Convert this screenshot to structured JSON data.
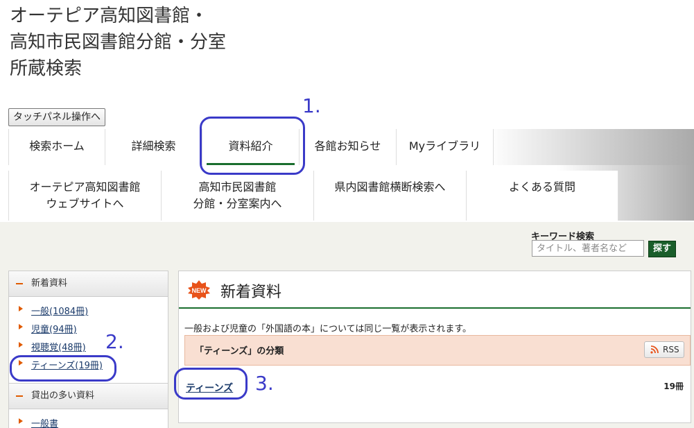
{
  "site_title": {
    "line1": "オーテピア高知図書館・",
    "line2": "高知市民図書館分館・分室",
    "line3": "所蔵検索"
  },
  "touch_panel_label": "タッチパネル操作へ",
  "nav_tabs": [
    {
      "label": "検索ホーム"
    },
    {
      "label": "詳細検索"
    },
    {
      "label": "資料紹介"
    },
    {
      "label": "各館お知らせ"
    },
    {
      "label": "Myライブラリ"
    }
  ],
  "nav_links": [
    {
      "line1": "オーテピア高知図書館",
      "line2": "ウェブサイトへ"
    },
    {
      "line1": "高知市民図書館",
      "line2": "分館・分室案内へ"
    },
    {
      "line1": "県内図書館横断検索へ",
      "line2": ""
    },
    {
      "line1": "よくある質問",
      "line2": ""
    }
  ],
  "keyword_search": {
    "label": "キーワード検索",
    "placeholder": "タイトル、著者名など",
    "button": "探す"
  },
  "sidebar": {
    "new_header": "新着資料",
    "new_items": [
      {
        "label": "一般(1084冊)"
      },
      {
        "label": "児童(94冊)"
      },
      {
        "label": "視聴覚(48冊)"
      },
      {
        "label": "ティーンズ(19冊)"
      }
    ],
    "popular_header": "貸出の多い資料",
    "popular_items": [
      {
        "label": "一般書"
      }
    ]
  },
  "main": {
    "badge": "NEW",
    "title": "新着資料",
    "note": "一般および児童の「外国語の本」については同じ一覧が表示されます。",
    "class_title": "「ティーンズ」の分類",
    "rss_label": "RSS",
    "result_link": "ティーンズ",
    "result_count": "19冊"
  },
  "annotations": [
    "1.",
    "2.",
    "3."
  ],
  "colors": {
    "accent_green": "#1a6e2e",
    "annotation_blue": "#3a3ac8",
    "bullet_orange": "#e05a00"
  }
}
